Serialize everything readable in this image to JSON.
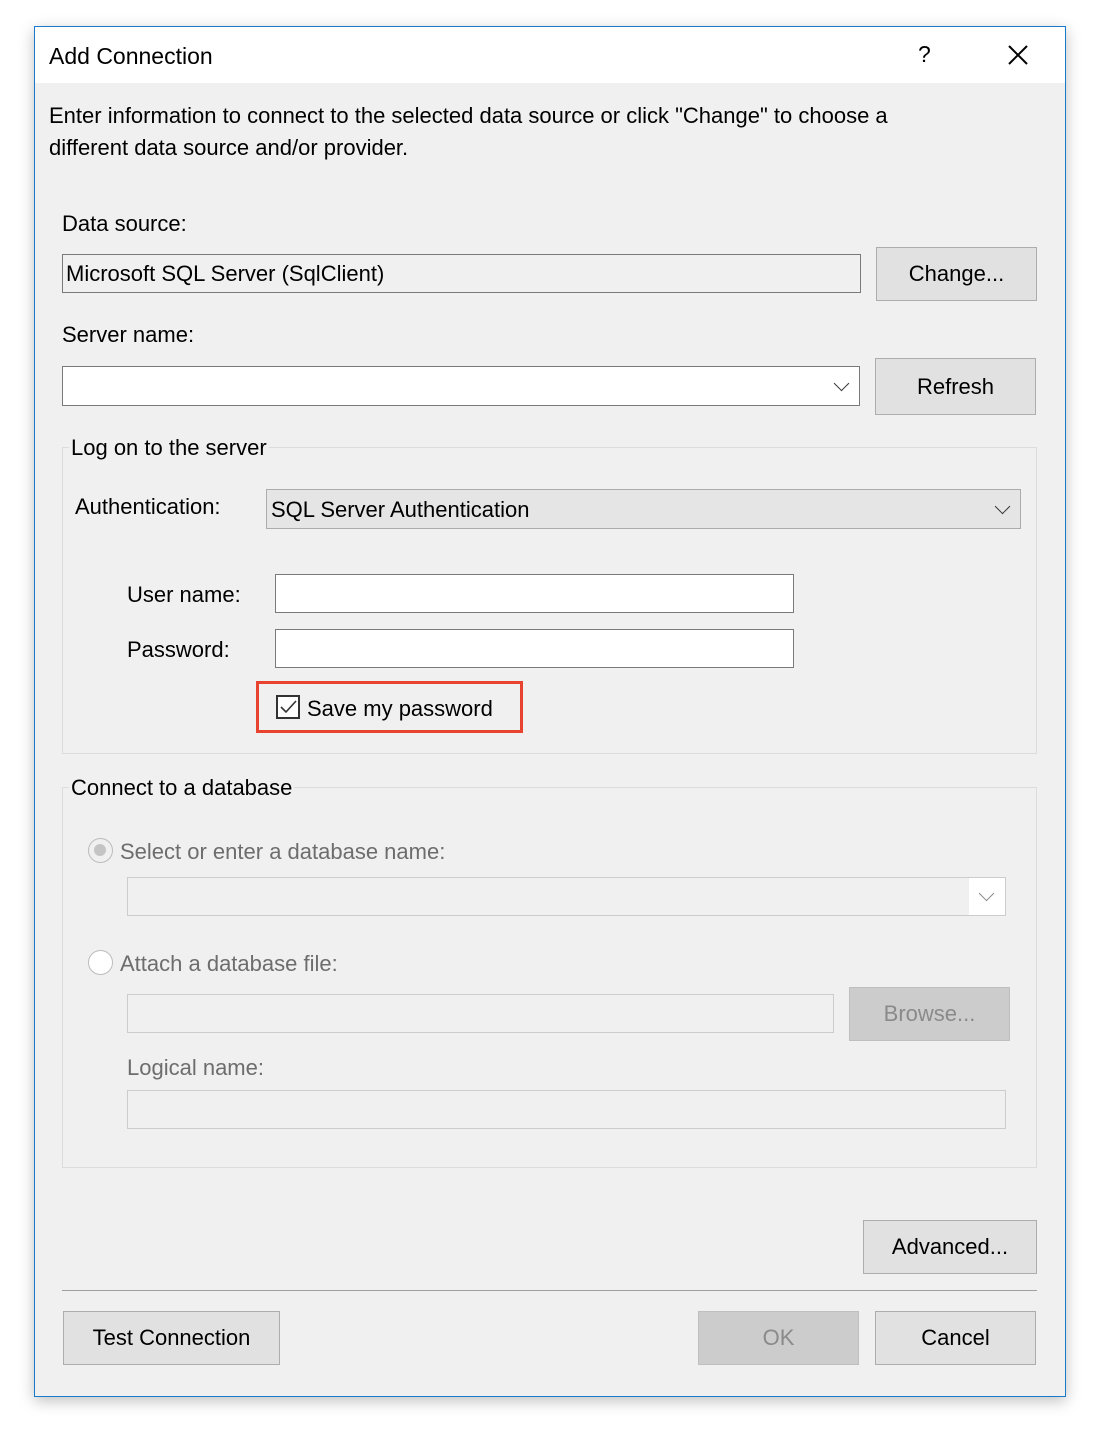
{
  "window": {
    "title": "Add Connection",
    "help_label": "?",
    "close_icon": "close-icon"
  },
  "intro": {
    "line1": "Enter information to connect to the selected data source or click \"Change\" to choose a",
    "line2": "different data source and/or provider."
  },
  "data_source": {
    "label": "Data source:",
    "value": "Microsoft SQL Server (SqlClient)",
    "change_label": "Change..."
  },
  "server": {
    "label": "Server name:",
    "value": "",
    "refresh_label": "Refresh"
  },
  "logon": {
    "legend": "Log on to the server",
    "auth_label": "Authentication:",
    "auth_value": "SQL Server Authentication",
    "user_label": "User name:",
    "user_value": "",
    "password_label": "Password:",
    "password_value": "",
    "save_password_label": "Save my password",
    "save_password_checked": true,
    "highlight_color": "#e8432e"
  },
  "database": {
    "legend": "Connect to a database",
    "select_label": "Select or enter a database name:",
    "select_value": "",
    "attach_label": "Attach a database file:",
    "attach_value": "",
    "browse_label": "Browse...",
    "logical_label": "Logical name:",
    "logical_value": ""
  },
  "footer": {
    "advanced_label": "Advanced...",
    "test_label": "Test Connection",
    "ok_label": "OK",
    "cancel_label": "Cancel"
  }
}
